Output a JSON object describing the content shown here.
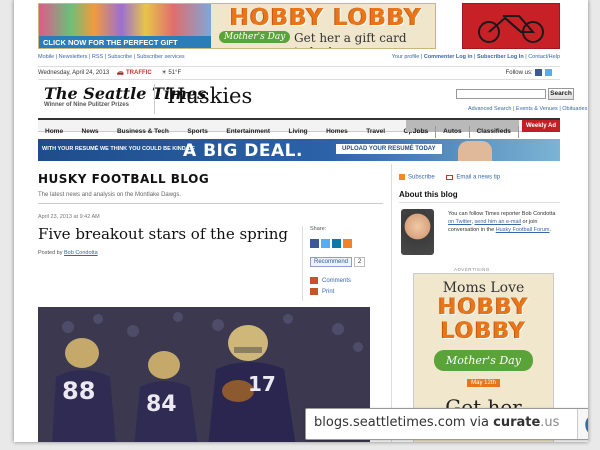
{
  "top_ad": {
    "cta": "CLICK NOW FOR THE PERFECT GIFT",
    "brand": "HOBBY LOBBY",
    "occasion": "Mother's Day",
    "tagline": "Get her a gift card today!"
  },
  "util_bar": {
    "left_links": "Mobile | Newsletters | RSS | Subscribe | Subscriber services",
    "profile": "Your profile",
    "commenter_login": "Commenter Log in",
    "subscriber_login": "Subscriber Log In",
    "contact": "Contact/Help"
  },
  "date_bar": {
    "date": "Wednesday, April 24, 2013",
    "traffic": "TRAFFIC",
    "weather": "51°F",
    "follow": "Follow us:"
  },
  "masthead": {
    "logo": "The Seattle Times",
    "sub": "Winner of Nine Pulitzer Prizes",
    "section": "Huskies",
    "search_button": "Search",
    "search_links": "Advanced Search | Events & Venues | Obituaries"
  },
  "nav": {
    "items": [
      "Home",
      "News",
      "Business & Tech",
      "Sports",
      "Entertainment",
      "Living",
      "Homes",
      "Travel",
      "Opinion"
    ],
    "alt_items": [
      "Jobs",
      "Autos",
      "Classifieds"
    ],
    "weekly_ad": "Weekly Ad"
  },
  "banner": {
    "small": "WITH YOUR RESUMÉ WE THINK YOU COULD BE KIND OF",
    "big": "A BIG DEAL.",
    "upload": "UPLOAD YOUR RESUMÉ TODAY"
  },
  "blog": {
    "title": "HUSKY FOOTBALL BLOG",
    "description": "The latest news and analysis on the Montlake Dawgs."
  },
  "post": {
    "date": "April 23, 2013 at 9:42 AM",
    "headline": "Five breakout stars of the spring",
    "posted_by": "Posted by",
    "author": "Bob Condotta"
  },
  "share": {
    "label": "Share:",
    "recommend": "Recommend",
    "recommend_count": "2",
    "comments": "Comments",
    "print": "Print"
  },
  "sidebar": {
    "subscribe": "Subscribe",
    "email_tip": "Email a news tip",
    "about_heading": "About this blog",
    "bio_1": "You can follow Times reporter Bob Condotta",
    "bio_twitter": "on Twitter",
    "bio_2": ",",
    "bio_email": "send him an e-mail",
    "bio_3": "or join conversation in the",
    "bio_forum": "Husky Football Forum",
    "bio_4": ".",
    "advertising": "ADVERTISING"
  },
  "side_ad": {
    "moms_love": "Moms Love",
    "brand_line1": "HOBBY",
    "brand_line2": "LOBBY",
    "occasion": "Mother's Day",
    "date": "May 12th",
    "get": "Get her"
  },
  "photo": {
    "jersey_numbers": [
      "88",
      "84",
      "17"
    ]
  },
  "curate": {
    "domain": "blogs.seattletimes.com",
    "via": " via ",
    "brand": "curate",
    "tld": ".us"
  },
  "colors": {
    "link": "#3a66a8",
    "brand_orange": "#e8751a",
    "weekly_ad_red": "#c21f25",
    "husky_purple": "#3d3a55"
  }
}
